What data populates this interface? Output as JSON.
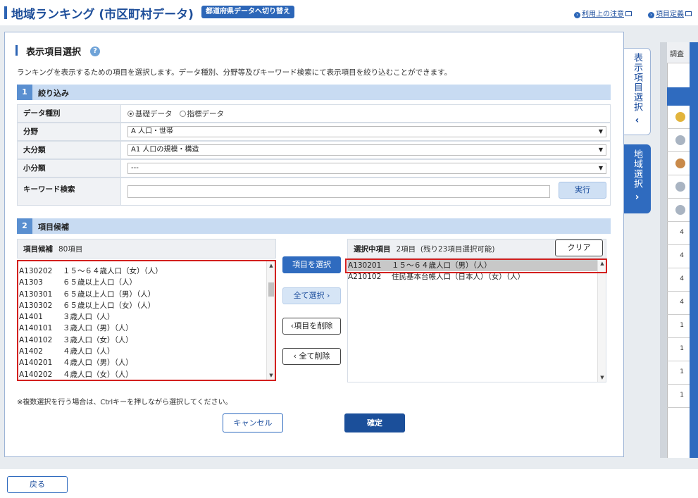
{
  "header": {
    "title": "地域ランキング (市区町村データ)",
    "switch_label": "都道府県データへ切り替え",
    "link_notice": "利用上の注意",
    "link_definition": "項目定義"
  },
  "section": {
    "title": "表示項目選択",
    "description": "ランキングを表示するための項目を選択します。データ種別、分野等及びキーワード検索にて表示項目を絞り込むことができます。"
  },
  "step1": {
    "num": "1",
    "label": "絞り込み",
    "rows": {
      "data_type_label": "データ種別",
      "field_label": "分野",
      "major_label": "大分類",
      "minor_label": "小分類",
      "keyword_label": "キーワード検索"
    },
    "radio_basic": "基礎データ",
    "radio_index": "指標データ",
    "field_value": "A 人口・世帯",
    "major_value": "A1 人口の規模・構造",
    "minor_value": "---",
    "keyword_value": "",
    "exec_label": "実行"
  },
  "step2": {
    "num": "2",
    "label": "項目候補",
    "candidates_title": "項目候補",
    "candidates_count": "80項目",
    "candidates": [
      {
        "code": "A130202",
        "name": "１５～６４歳人口（女）（人）"
      },
      {
        "code": "A1303",
        "name": "６５歳以上人口（人）"
      },
      {
        "code": "A130301",
        "name": "６５歳以上人口（男）（人）"
      },
      {
        "code": "A130302",
        "name": "６５歳以上人口（女）（人）"
      },
      {
        "code": "A1401",
        "name": "３歳人口（人）"
      },
      {
        "code": "A140101",
        "name": "３歳人口（男）（人）"
      },
      {
        "code": "A140102",
        "name": "３歳人口（女）（人）"
      },
      {
        "code": "A1402",
        "name": "４歳人口（人）"
      },
      {
        "code": "A140201",
        "name": "４歳人口（男）（人）"
      },
      {
        "code": "A140202",
        "name": "４歳人口（女）（人）"
      }
    ],
    "selected_title": "選択中項目",
    "selected_count": "2項目",
    "selected_remaining": "(残り23項目選択可能)",
    "clear_label": "クリア",
    "selected": [
      {
        "code": "A130201",
        "name": "１５～６４歳人口（男）（人）"
      },
      {
        "code": "A210102",
        "name": "住民基本台帳人口（日本人）（女）（人）"
      }
    ],
    "btn_select": "項目を選択",
    "btn_select_all": "全て選択",
    "btn_delete": "項目を削除",
    "btn_delete_all": "全て削除"
  },
  "footer": {
    "note": "※複数選択を行う場合は、Ctrlキーを押しながら選択してください。",
    "cancel_label": "キャンセル",
    "ok_label": "確定",
    "back_label": "戻る"
  },
  "sidetabs": {
    "tab1": "表示項目選択",
    "tab2": "地域選択"
  },
  "right_panel": {
    "head": "調査",
    "numbers": [
      "4",
      "4",
      "4",
      "4",
      "1",
      "1",
      "1",
      "1"
    ]
  },
  "colors": {
    "accent": "#2f6bbf",
    "highlight_border": "#d3201e",
    "step_bar": "#c8dbf2"
  }
}
